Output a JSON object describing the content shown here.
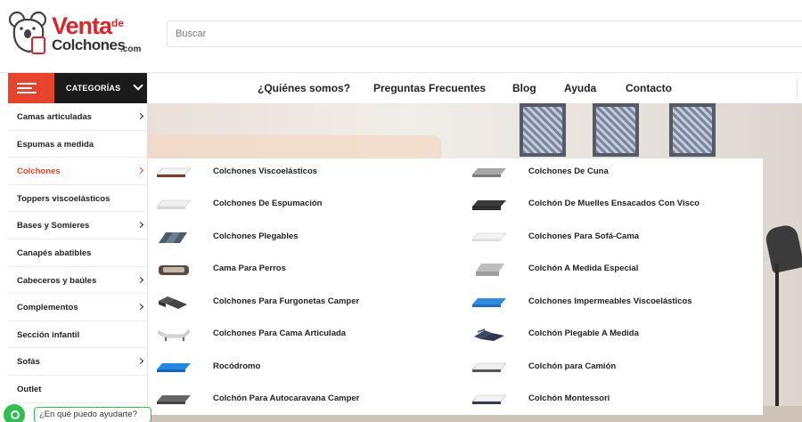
{
  "brand": {
    "name_part1": "Venta",
    "name_de": "de",
    "name_part2": "Colchones",
    "name_tld": ".com"
  },
  "search": {
    "placeholder": "Buscar"
  },
  "categories_button": {
    "label": "CATEGORÍAS"
  },
  "topnav": [
    {
      "label": "¿Quiénes somos?"
    },
    {
      "label": "Preguntas Frecuentes"
    },
    {
      "label": "Blog"
    },
    {
      "label": "Ayuda"
    },
    {
      "label": "Contacto"
    }
  ],
  "sidebar": {
    "items": [
      {
        "label": "Camas articuladas",
        "has_submenu": true
      },
      {
        "label": "Espumas a medida",
        "has_submenu": false
      },
      {
        "label": "Colchones",
        "has_submenu": true,
        "active": true
      },
      {
        "label": "Toppers viscoelásticos",
        "has_submenu": false
      },
      {
        "label": "Bases y Somieres",
        "has_submenu": true
      },
      {
        "label": "Canapés abatibles",
        "has_submenu": false
      },
      {
        "label": "Cabeceros y baúles",
        "has_submenu": true
      },
      {
        "label": "Complementos",
        "has_submenu": true
      },
      {
        "label": "Sección infantil",
        "has_submenu": false
      },
      {
        "label": "Sofás",
        "has_submenu": true
      },
      {
        "label": "Outlet",
        "has_submenu": false
      }
    ]
  },
  "megamenu": {
    "left": [
      {
        "label": "Colchones Viscoelásticos",
        "icon": "mattress-visco-icon"
      },
      {
        "label": "Colchones De Espumación",
        "icon": "mattress-foam-icon"
      },
      {
        "label": "Colchones Plegables",
        "icon": "folding-mattress-icon"
      },
      {
        "label": "Cama Para Perros",
        "icon": "dog-bed-icon"
      },
      {
        "label": "Colchones Para Furgonetas Camper",
        "icon": "camper-mattress-icon"
      },
      {
        "label": "Colchones Para Cama Articulada",
        "icon": "adjustable-bed-icon"
      },
      {
        "label": "Rocódromo",
        "icon": "climbing-mat-icon"
      },
      {
        "label": "Colchón Para Autocaravana Camper",
        "icon": "motorhome-mattress-icon"
      }
    ],
    "right": [
      {
        "label": "Colchones De Cuna",
        "icon": "crib-mattress-icon"
      },
      {
        "label": "Colchón De Muelles Ensacados Con Visco",
        "icon": "pocket-spring-mattress-icon"
      },
      {
        "label": "Colchones Para Sofá-Cama",
        "icon": "sofa-bed-mattress-icon"
      },
      {
        "label": "Colchón A Medida Especial",
        "icon": "custom-mattress-icon"
      },
      {
        "label": "Colchones Impermeables Viscoelásticos",
        "icon": "waterproof-mattress-icon"
      },
      {
        "label": "Colchón Plegable A Medida",
        "icon": "custom-folding-mattress-icon"
      },
      {
        "label": "Colchón para Camión",
        "icon": "truck-mattress-icon"
      },
      {
        "label": "Colchón Montessori",
        "icon": "montessori-mattress-icon"
      }
    ]
  },
  "whatsapp": {
    "label": "¿En qué puedo ayudarte?"
  },
  "colors": {
    "accent": "#e8442b",
    "brand_red": "#d8262a",
    "dark": "#1b1b1b",
    "whatsapp": "#2fbf4f"
  }
}
